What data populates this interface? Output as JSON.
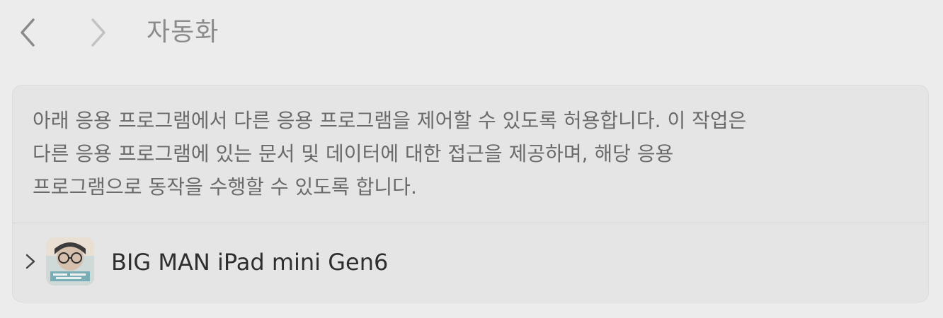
{
  "toolbar": {
    "back_icon": "chevron-left-icon",
    "forward_icon": "chevron-right-icon",
    "title": "자동화"
  },
  "panel": {
    "description": "아래 응용 프로그램에서 다른 응용 프로그램을 제어할 수 있도록 허용합니다. 이 작업은\n다른 응용 프로그램에 있는 문서 및 데이터에 대한 접근을 제공하며, 해당 응용\n프로그램으로 동작을 수행할 수 있도록 합니다.",
    "apps": [
      {
        "name": "BIG MAN iPad mini Gen6",
        "icon": "app-thumbnail-icon",
        "expand_icon": "chevron-right-icon"
      }
    ]
  },
  "colors": {
    "background": "#ececec",
    "panel": "#e5e5e5",
    "title": "#8b8b8b",
    "body_text": "#6a6a6a",
    "row_text": "#2e2e2e"
  }
}
